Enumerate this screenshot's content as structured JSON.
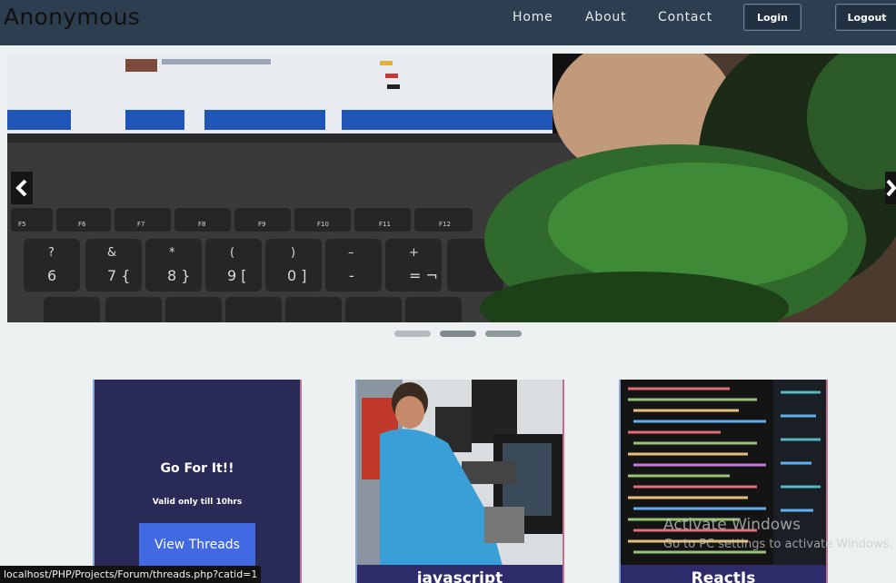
{
  "navbar": {
    "brand": "Anonymous",
    "links": [
      "Home",
      "About",
      "Contact"
    ],
    "login_label": "Login",
    "logout_label": "Logout",
    "background": "#2c3e50"
  },
  "carousel": {
    "slides": 3,
    "active_slide": 2,
    "prev_icon": "chevron-left-icon",
    "next_icon": "chevron-right-icon",
    "keyboard_keys": [
      "F5",
      "F6",
      "F7",
      "F8",
      "F9",
      "F10",
      "F11",
      "F12",
      "?",
      "&",
      "*",
      "(",
      ")",
      "–",
      "+",
      "6",
      "7 {",
      "8 }",
      "9 [",
      "0 ]",
      "-",
      "= ¬"
    ]
  },
  "cards": {
    "promo": {
      "title": "Go For It!!",
      "subtitle": "Valid only till 10hrs",
      "button_label": "View Threads",
      "accent": "#4169e1"
    },
    "javascript_label": "javascript",
    "react_label": "ReactJs"
  },
  "watermark": {
    "line1": "Activate Windows",
    "line2": "Go to PC settings to activate Windows."
  },
  "status_bar": {
    "url": "localhost/PHP/Projects/Forum/threads.php?catid=1"
  }
}
